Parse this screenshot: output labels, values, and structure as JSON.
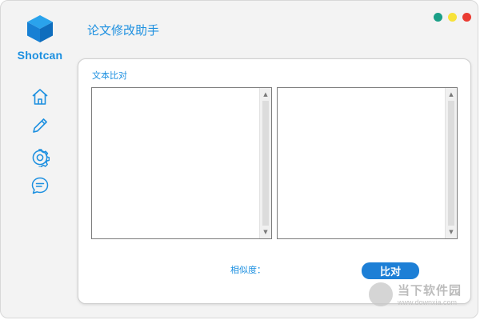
{
  "app": {
    "logo_text": "Shotcan",
    "title": "论文修改助手"
  },
  "sidebar": {
    "items": [
      {
        "icon": "home-icon"
      },
      {
        "icon": "pencil-icon"
      },
      {
        "icon": "gear-icon"
      },
      {
        "icon": "chat-icon"
      }
    ]
  },
  "window_controls": {
    "colors": [
      "#1a9f87",
      "#f7e23a",
      "#ea3b32"
    ]
  },
  "panel": {
    "title": "文本比对",
    "left_text": "",
    "right_text": "",
    "similarity_label": "相似度：",
    "similarity_value": "",
    "compare_label": "比对"
  },
  "watermark": {
    "text": "当下软件园",
    "url": "www.downxia.com"
  },
  "colors": {
    "accent": "#1b8fe0",
    "button": "#1d7fd6"
  }
}
